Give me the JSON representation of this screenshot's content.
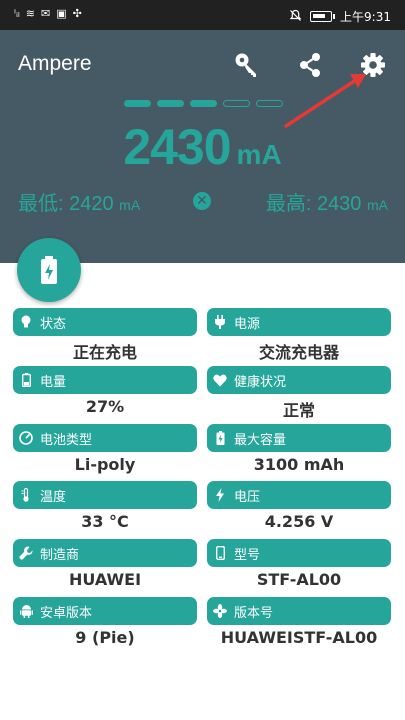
{
  "status_bar": {
    "left_glyphs": [
      "ⁱᵢₗ",
      "≋",
      "✉",
      "▣",
      "✣"
    ],
    "time": "上午9:31"
  },
  "app": {
    "title": "Ampere"
  },
  "header": {
    "icons": [
      "key-icon",
      "share-icon",
      "gear-icon"
    ],
    "level_segments_filled": 3,
    "level_segments_total": 5,
    "current_value": "2430",
    "current_unit": "mA",
    "min_label": "最低: 2420",
    "min_unit": "mA",
    "max_label": "最高: 2430",
    "max_unit": "mA",
    "reset_glyph": "✕"
  },
  "colors": {
    "accent": "#26a69a",
    "header_bg": "#455a64",
    "status_bg": "#212121"
  },
  "info": [
    {
      "label": "状态",
      "value": "正在充电",
      "icon": "bulb-icon"
    },
    {
      "label": "电源",
      "value": "交流充电器",
      "icon": "plug-icon"
    },
    {
      "label": "电量",
      "value": "27%",
      "icon": "battery-icon"
    },
    {
      "label": "健康状况",
      "value": "正常",
      "icon": "heart-icon"
    },
    {
      "label": "电池类型",
      "value": "Li-poly",
      "icon": "speedometer-icon"
    },
    {
      "label": "最大容量",
      "value": "3100 mAh",
      "icon": "battery-charging-icon"
    },
    {
      "label": "温度",
      "value": "33 °C",
      "icon": "thermometer-icon"
    },
    {
      "label": "电压",
      "value": "4.256 V",
      "icon": "lightning-icon"
    },
    {
      "label": "制造商",
      "value": "HUAWEI",
      "icon": "wrench-icon"
    },
    {
      "label": "型号",
      "value": "STF-AL00",
      "icon": "phone-icon"
    },
    {
      "label": "安卓版本",
      "value": "9 (Pie)",
      "icon": "android-icon"
    },
    {
      "label": "版本号",
      "value": "HUAWEISTF-AL00",
      "icon": "fan-icon"
    }
  ]
}
